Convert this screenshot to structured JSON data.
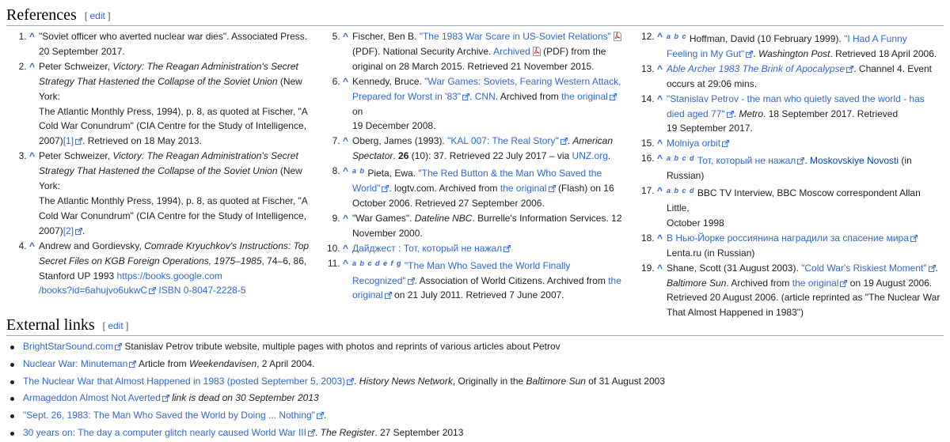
{
  "references": {
    "heading": "References",
    "edit": "edit",
    "col1": [
      {
        "n": "1.",
        "lines": [
          "\"Soviet officer who averted nuclear war dies\". Associated Press.",
          "20 September 2017."
        ]
      },
      {
        "n": "2.",
        "l1a": "Peter Schweizer, ",
        "l1b": "Victory: The Reagan Administration's Secret",
        "l2": "Strategy That Hastened the Collapse of the Soviet Union",
        "l2b": " (New York:",
        "l3": "The Atlantic Monthly Press, 1994), p. 8, as quoted at Fischer, \"A",
        "l4": "Cold War Conundrum\" (CIA Centre for the Study of Intelligence,",
        "l5a": "2007)",
        "l5link": "[1]",
        "l5b": ". Retrieved on 18 May 2013."
      },
      {
        "n": "3.",
        "l1a": "Peter Schweizer, ",
        "l1b": "Victory: The Reagan Administration's Secret",
        "l2": "Strategy That Hastened the Collapse of the Soviet Union",
        "l2b": " (New York:",
        "l3": "The Atlantic Monthly Press, 1994), p. 8, as quoted at Fischer, \"A",
        "l4": "Cold War Conundrum\" (CIA Centre for the Study of Intelligence,",
        "l5a": "2007)",
        "l5link": "[2]",
        "l5b": "."
      },
      {
        "n": "4.",
        "l1a": "Andrew and Gordievsky, ",
        "l1b": "Comrade Kryuchkov's Instructions: Top",
        "l2": "Secret Files on KGB Foreign Operations, 1975–1985",
        "l2b": ", 74–6, 86,",
        "l3a": "Stanford UP 1993 ",
        "l3link": "https://books.google.com",
        "l4link": "/books?id=6ahujvo6ukwC",
        "l4b": " ISBN 0-8047-2228-5"
      }
    ],
    "col2": {
      "r5": {
        "n": "5.",
        "a": "Fischer, Ben B. ",
        "link": "\"The 1983 War Scare in US-Soviet Relations\"",
        "l2a": "(PDF). National Security Archive. ",
        "l2link": "Archived",
        "l2b": " (PDF) from the",
        "l3": "original on 28 March 2015. Retrieved 21 November 2015."
      },
      "r6": {
        "n": "6.",
        "a": "Kennedy, Bruce. ",
        "link": "\"War Games: Soviets, Fearing Western Attack,",
        "l2link": "Prepared for Worst in '83\"",
        "l2b": ". ",
        "cnn": "CNN",
        "l2c": ". Archived from ",
        "orig": "the original",
        "l2d": " on",
        "l3": "19 December 2008."
      },
      "r7": {
        "n": "7.",
        "a": "Oberg, James (1993). ",
        "link": "\"KAL 007: The Real Story\"",
        "b": ". ",
        "it": "American",
        "l2it": "Spectator",
        "l2a": ". ",
        "vol": "26",
        "l2b": " (10): 37. Retrieved 22 July 2017 – via ",
        "unz": "UNZ.org",
        "l2c": "."
      },
      "r8": {
        "n": "8.",
        "sup": "a b",
        "a": " Pieta, Ewa. ",
        "link": "\"The Red Button & the Man Who Saved the",
        "l2link": "World\"",
        "l2a": ". logtv.com. Archived from ",
        "orig": "the original",
        "l2b": " (Flash) on 16",
        "l3": "October 2006. Retrieved 27 September 2006."
      },
      "r9": {
        "n": "9.",
        "a": "\"War Games\". ",
        "it": "Dateline NBC",
        "b": ". Burrelle's Information Services. 12",
        "l2": "November 2000."
      },
      "r10": {
        "n": "10.",
        "link": "Дайджест : Тот, который не нажал"
      },
      "r11": {
        "n": "11.",
        "sup": "a b c d e f g",
        "link": "\"The Man Who Saved the World Finally",
        "l2link": "Recognized\"",
        "l2a": ". Association of World Citizens. Archived from ",
        "the": "the",
        "l3link": "original",
        "l3a": " on 21 July 2011. Retrieved 7 June 2007."
      }
    },
    "col3": {
      "r12": {
        "n": "12.",
        "sup": "a b c",
        "a": " Hoffman, David (10 February 1999). ",
        "link": "\"I Had A Funny",
        "l2link": "Feeling in My Gut\"",
        "l2a": ". ",
        "it": "Washington Post",
        "l2b": ". Retrieved 18 April 2006."
      },
      "r13": {
        "n": "13.",
        "link": "Able Archer 1983 The Brink of Apocalypse",
        "a": ". Channel 4. Event",
        "l2": "occurs at 29:06 mins."
      },
      "r14": {
        "n": "14.",
        "link": "\"Stanislav Petrov - the man who quietly saved the world - has",
        "l2link": "died aged 77\"",
        "l2a": ". ",
        "it": "Metro",
        "l2b": ". 18 September 2017. Retrieved",
        "l3": "19 September 2017."
      },
      "r15": {
        "n": "15.",
        "link": "Molniya orbit"
      },
      "r16": {
        "n": "16.",
        "sup": "a b c d",
        "link": "Тот, который не нажал",
        "a": ". ",
        "mn": "Moskovskiye Novosti",
        "b": " (in",
        "l2": "Russian)"
      },
      "r17": {
        "n": "17.",
        "sup": "a b c d",
        "a": " BBC TV Interview, BBC Moscow correspondent Allan Little,",
        "l2": "October 1998"
      },
      "r18": {
        "n": "18.",
        "link": "В Нью-Йорке россиянина наградили за спасение мира",
        "l2": "Lenta.ru (in Russian)"
      },
      "r19": {
        "n": "19.",
        "a": "Shane, Scott (31 August 2003). ",
        "link": "\"Cold War's Riskiest Moment\"",
        "b": ".",
        "l2it": "Baltimore Sun",
        "l2a": ". Archived from ",
        "orig": "the original",
        "l2b": " on 19 August 2006.",
        "l3": "Retrieved 20 August 2006. (article reprinted as \"The Nuclear War",
        "l4": "That Almost Happened in 1983\")"
      }
    }
  },
  "external": {
    "heading": "External links",
    "edit": "edit",
    "items": [
      {
        "link": "BrightStarSound.com",
        "text": " Stanislav Petrov tribute website, multiple pages with photos and reprints of various articles about Petrov"
      },
      {
        "link": "Nuclear War: Minuteman",
        "text": " Article from ",
        "it": "Weekendavisen",
        "text2": ", 2 April 2004."
      },
      {
        "link": "The Nuclear War that Almost Happened in 1983 (posted September 5, 2003)",
        "text": ". ",
        "it": "History News Network",
        "text2": ", Originally in the ",
        "it2": "Baltimore Sun",
        "text3": " of 31 August 2003"
      },
      {
        "link": "Armageddon Almost Not Averted",
        "it": " link is dead on 30 September 2013"
      },
      {
        "link": "\"Sept. 26, 1983: The Man Who Saved the World by Doing ... Nothing\"",
        "text": "."
      },
      {
        "link": "30 years on: The day a computer glitch nearly caused World War III",
        "text": ". ",
        "it": "The Register",
        "text2": ". 27 September 2013"
      }
    ]
  },
  "icons": {
    "caret": "^",
    "external": "external-link-icon",
    "pdf": "pdf-icon"
  },
  "colors": {
    "link": "#3366cc",
    "text": "#202122",
    "rule": "#a2a9b1"
  }
}
